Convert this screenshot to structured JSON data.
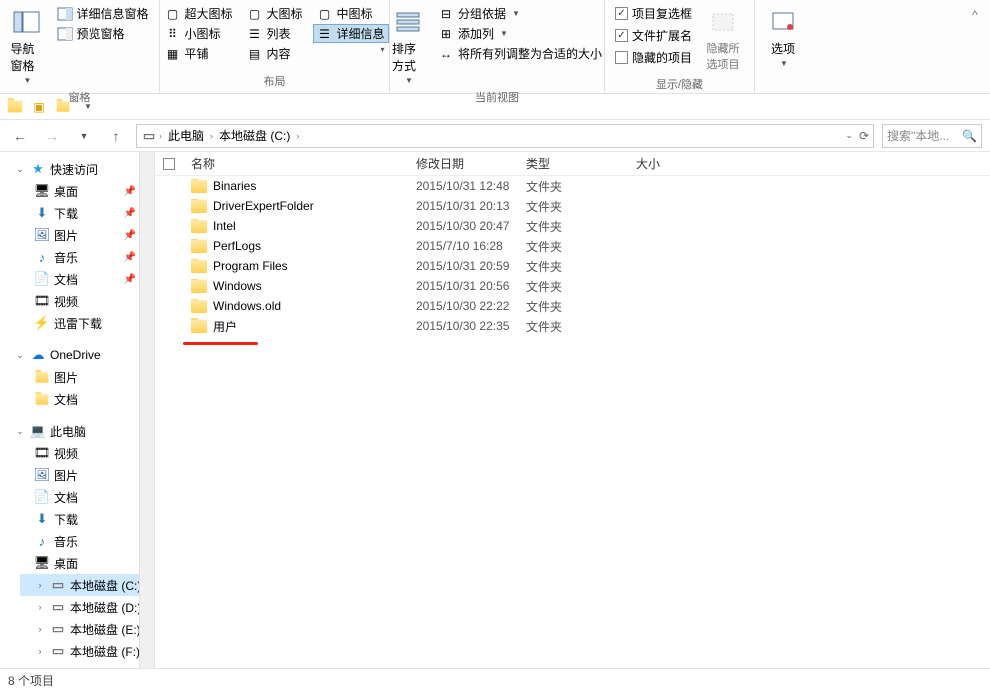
{
  "ribbon": {
    "groups": {
      "panes": {
        "label": "窗格",
        "nav_pane": "导航窗格",
        "detail_info": "详细信息窗格",
        "preview_pane": "预览窗格"
      },
      "layout": {
        "label": "布局",
        "xl_icons": "超大图标",
        "l_icons": "大图标",
        "m_icons": "中图标",
        "s_icons": "小图标",
        "list": "列表",
        "details": "详细信息",
        "tiles": "平铺",
        "content": "内容"
      },
      "current_view": {
        "label": "当前视图",
        "sort": "排序方式",
        "group_by": "分组依据",
        "add_cols": "添加列",
        "autosize": "将所有列调整为合适的大小"
      },
      "show_hide": {
        "label": "显示/隐藏",
        "item_checkboxes": "项目复选框",
        "file_ext": "文件扩展名",
        "hidden_items": "隐藏的项目",
        "hide_selected": "隐藏所选项目"
      },
      "options": {
        "label": "",
        "options": "选项"
      }
    }
  },
  "breadcrumb": {
    "pc": "此电脑",
    "drive": "本地磁盘 (C:)"
  },
  "search": {
    "placeholder": "搜索\"本地..."
  },
  "tree": {
    "quick": "快速访问",
    "desktop": "桌面",
    "downloads": "下载",
    "pictures": "图片",
    "music": "音乐",
    "docs": "文档",
    "videos": "视频",
    "xunlei": "迅雷下载",
    "onedrive": "OneDrive",
    "od_pics": "图片",
    "od_docs": "文档",
    "thispc": "此电脑",
    "pc_videos": "视频",
    "pc_pics": "图片",
    "pc_docs": "文档",
    "pc_dl": "下载",
    "pc_music": "音乐",
    "pc_desktop": "桌面",
    "drive_c": "本地磁盘 (C:)",
    "drive_d": "本地磁盘 (D:)",
    "drive_e": "本地磁盘 (E:)",
    "drive_f": "本地磁盘 (F:)"
  },
  "columns": {
    "name": "名称",
    "date": "修改日期",
    "type": "类型",
    "size": "大小"
  },
  "files": [
    {
      "name": "Binaries",
      "date": "2015/10/31 12:48",
      "type": "文件夹"
    },
    {
      "name": "DriverExpertFolder",
      "date": "2015/10/31 20:13",
      "type": "文件夹"
    },
    {
      "name": "Intel",
      "date": "2015/10/30 20:47",
      "type": "文件夹"
    },
    {
      "name": "PerfLogs",
      "date": "2015/7/10 16:28",
      "type": "文件夹"
    },
    {
      "name": "Program Files",
      "date": "2015/10/31 20:59",
      "type": "文件夹"
    },
    {
      "name": "Windows",
      "date": "2015/10/31 20:56",
      "type": "文件夹"
    },
    {
      "name": "Windows.old",
      "date": "2015/10/30 22:22",
      "type": "文件夹"
    },
    {
      "name": "用户",
      "date": "2015/10/30 22:35",
      "type": "文件夹"
    }
  ],
  "status": {
    "count": "8 个项目"
  }
}
